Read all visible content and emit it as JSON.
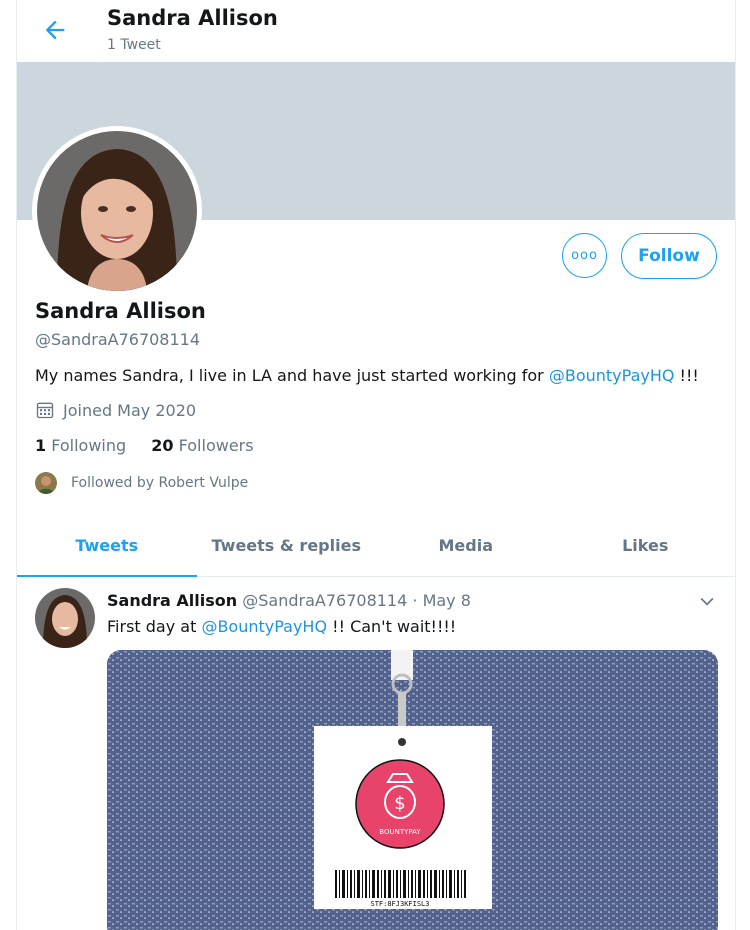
{
  "header": {
    "name": "Sandra Allison",
    "tweet_count": "1 Tweet"
  },
  "profile": {
    "more_label": "ooo",
    "follow_label": "Follow",
    "name": "Sandra Allison",
    "handle": "@SandraA76708114",
    "bio_text": "My names Sandra, I live in LA and have just started working for ",
    "bio_link": "@BountyPayHQ",
    "bio_end": " !!!",
    "joined": "Joined May 2020",
    "following_count": "1",
    "following_label": "Following",
    "followers_count": "20",
    "followers_label": "Followers",
    "followed_by": "Followed by Robert Vulpe"
  },
  "tabs": [
    "Tweets",
    "Tweets & replies",
    "Media",
    "Likes"
  ],
  "tweet": {
    "name": "Sandra Allison",
    "handle": "@SandraA76708114",
    "dot": " · ",
    "date": "May 8",
    "text_start": "First day at ",
    "text_link": "@BountyPayHQ",
    "text_end": " !! Can't wait!!!!",
    "badge_brand": "BOUNTYPAY",
    "badge_code": "STF:8FJ3KFISL3"
  },
  "colors": {
    "accent": "#1da1f2",
    "banner": "#ccd6dd",
    "badge_pink": "#e8436b"
  },
  "icons": [
    "back-arrow-icon",
    "more-icon",
    "calendar-icon",
    "chevron-down-icon"
  ]
}
